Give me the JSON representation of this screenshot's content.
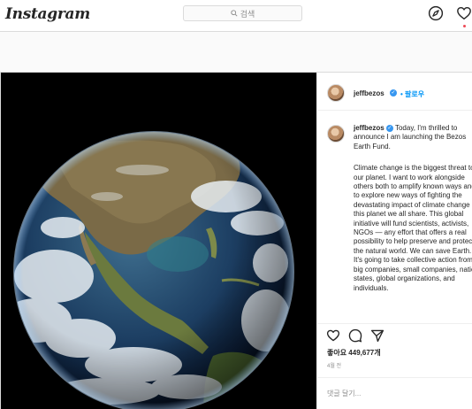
{
  "header": {
    "logo_text": "Instagram",
    "search_placeholder": "검색",
    "icons": [
      "explore-compass-icon",
      "activity-heart-icon"
    ],
    "accent_colors": {
      "notification_dot": "#ed4956",
      "link": "#0095f6",
      "verified": "#3897f0"
    }
  },
  "post": {
    "header": {
      "username": "jeffbezos",
      "follow_label": "팔로우"
    },
    "caption": {
      "username": "jeffbezos",
      "first_line": " Today, I'm thrilled to announce I am launching the Bezos Earth Fund.",
      "body": "Climate change is the biggest threat to our planet. I want to work alongside others both to amplify known ways and to explore new ways of fighting the devastating impact of climate change on this planet we all share. This global initiative will fund scientists, activists, NGOs — any effort that offers a real possibility to help preserve and protect the natural world. We can save Earth. It's going to take collective action from big companies, small companies, nation states, global organizations, and individuals."
    },
    "actions": {
      "icons": [
        "like-heart-icon",
        "comment-bubble-icon",
        "share-plane-icon"
      ],
      "likes_text": "좋아요 449,677개",
      "time_text": "4월 전"
    },
    "comment": {
      "placeholder": "댓글 달기..."
    }
  }
}
